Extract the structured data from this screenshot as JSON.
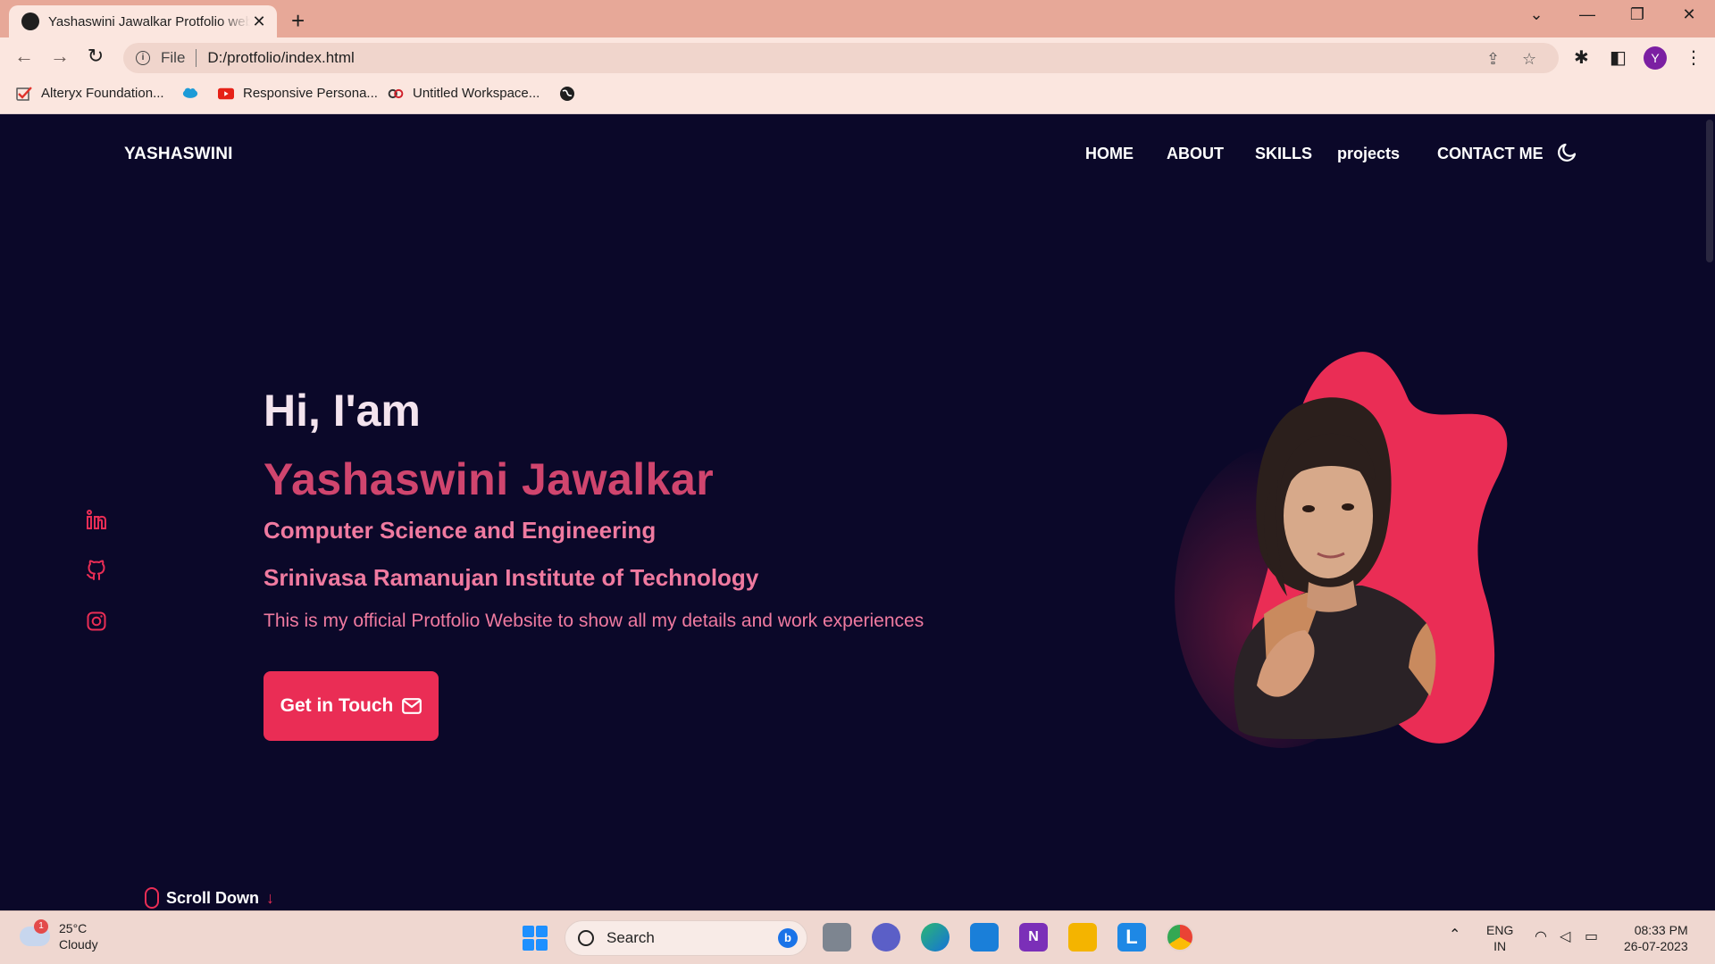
{
  "browser": {
    "tab_title": "Yashaswini Jawalkar Protfolio website",
    "new_tab": "+",
    "close": "✕",
    "omnibox_scheme": "File",
    "url": "D:/protfolio/index.html",
    "profile_initial": "Y",
    "bookmarks": [
      {
        "label": "Alteryx Foundation...",
        "icon": "checkmark-icon",
        "color": "#e0322b"
      },
      {
        "label": "",
        "icon": "salesforce-cloud-icon",
        "color": "#1d9bd7"
      },
      {
        "label": "Responsive Persona...",
        "icon": "youtube-icon",
        "color": "#e62117"
      },
      {
        "label": "Untitled Workspace...",
        "icon": "link-icon",
        "color": "#d0202a"
      },
      {
        "label": "",
        "icon": "globe-icon",
        "color": "#1f1f1f"
      }
    ]
  },
  "site": {
    "logo": "YASHASWINI",
    "nav": [
      "HOME",
      "ABOUT",
      "SKILLS",
      "projects",
      "CONTACT ME"
    ],
    "greeting": "Hi, I'am",
    "name": "Yashaswini Jawalkar",
    "field": "Computer Science and Engineering",
    "institute": "Srinivasa Ramanujan Institute of Technology",
    "description": "This is my official Protfolio Website to show all my details and work experiences",
    "cta_label": "Get in Touch",
    "scroll_label": "Scroll Down",
    "socials": [
      "linkedin-icon",
      "github-icon",
      "instagram-icon"
    ],
    "accent_color": "#ea2d55",
    "background_color": "#0b0829"
  },
  "taskbar": {
    "weather_temp": "25°C",
    "weather_cond": "Cloudy",
    "weather_badge": "1",
    "search_label": "Search",
    "lang_top": "ENG",
    "lang_bottom": "IN",
    "time": "08:33 PM",
    "date": "26-07-2023",
    "apps": [
      "task-view-icon",
      "teams-icon",
      "edge-icon",
      "mail-icon",
      "onenote-icon",
      "file-explorer-icon",
      "l-app-icon",
      "chrome-icon"
    ]
  }
}
